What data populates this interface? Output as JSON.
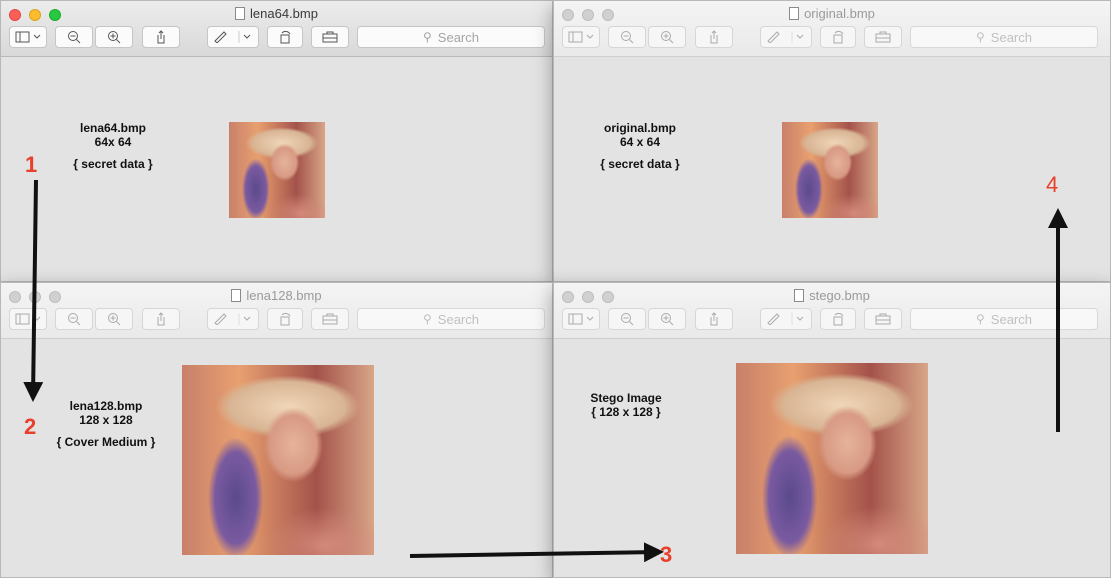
{
  "windows": [
    {
      "id": "w1",
      "title": "lena64.bmp",
      "active": true,
      "caption": [
        "lena64.bmp",
        "64x 64",
        "",
        "{ secret data }"
      ]
    },
    {
      "id": "w2",
      "title": "original.bmp",
      "active": false,
      "caption": [
        "original.bmp",
        "64 x 64",
        "",
        "{ secret data }"
      ]
    },
    {
      "id": "w3",
      "title": "lena128.bmp",
      "active": false,
      "caption": [
        "lena128.bmp",
        "128 x 128",
        "",
        "{ Cover Medium }"
      ]
    },
    {
      "id": "w4",
      "title": "stego.bmp",
      "active": false,
      "caption": [
        "Stego Image",
        "{ 128 x 128 }"
      ]
    }
  ],
  "toolbar": {
    "search_placeholder": "Search"
  },
  "annotations": {
    "step1": "1",
    "step2": "2",
    "step3": "3",
    "step4": "4"
  }
}
